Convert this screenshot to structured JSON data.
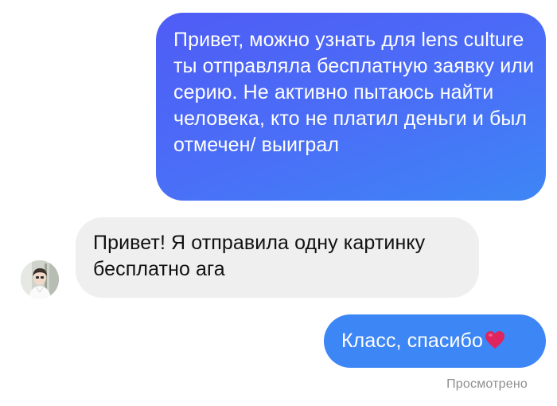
{
  "thread": {
    "messages": [
      {
        "sender": "me",
        "text": "Привет, можно узнать для lens culture ты отправляла бесплатную заявку или серию. Не активно пытаюсь найти человека, кто не платил деньги и был отмечен/ выиграл"
      },
      {
        "sender": "contact",
        "text": "Привет! Я отправила одну картинку бесплатно ага"
      },
      {
        "sender": "me",
        "text": "Класс, спасибо",
        "emoji": "heart-emoji"
      }
    ],
    "seen_status": "Просмотрено"
  },
  "colors": {
    "outgoing_bubble_start": "#4f5cf6",
    "outgoing_bubble_end": "#3d86f5",
    "incoming_bubble": "#efefef",
    "heart": "#e0245e",
    "status_text": "#8e8e8e"
  }
}
